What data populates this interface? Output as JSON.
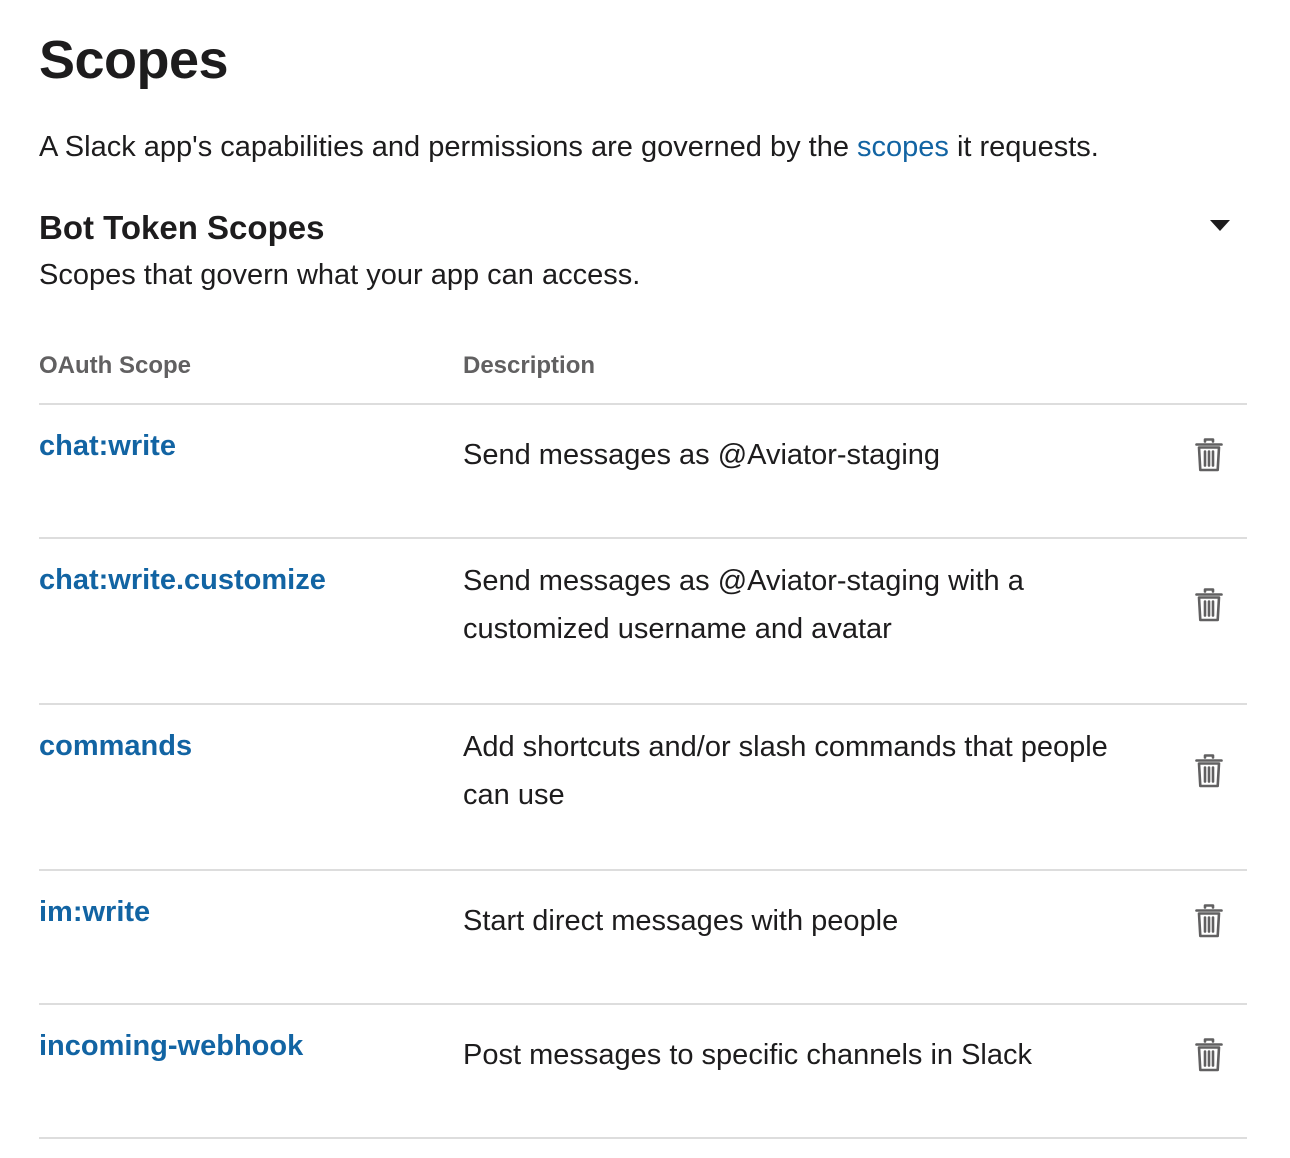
{
  "header": {
    "title": "Scopes"
  },
  "intro": {
    "text_before": "A Slack app's capabilities and permissions are governed by the ",
    "link_label": "scopes",
    "text_after": " it requests."
  },
  "bot_token_section": {
    "title": "Bot Token Scopes",
    "subtitle": "Scopes that govern what your app can access.",
    "toggle_icon": "caret-down-icon"
  },
  "table": {
    "columns": [
      "OAuth Scope",
      "Description"
    ],
    "rows": [
      {
        "scope": "chat:write",
        "description": "Send messages as @Aviator-staging"
      },
      {
        "scope": "chat:write.customize",
        "description": "Send messages as @Aviator-staging with a customized username and avatar"
      },
      {
        "scope": "commands",
        "description": "Add shortcuts and/or slash commands that people can use"
      },
      {
        "scope": "im:write",
        "description": "Start direct messages with people"
      },
      {
        "scope": "incoming-webhook",
        "description": "Post messages to specific channels in Slack"
      }
    ],
    "row_action_icon": "trash-icon"
  },
  "colors": {
    "link": "#1264a3",
    "text": "#1d1c1d",
    "muted": "#616061",
    "divider": "#dddddd",
    "icon": "#616061"
  }
}
